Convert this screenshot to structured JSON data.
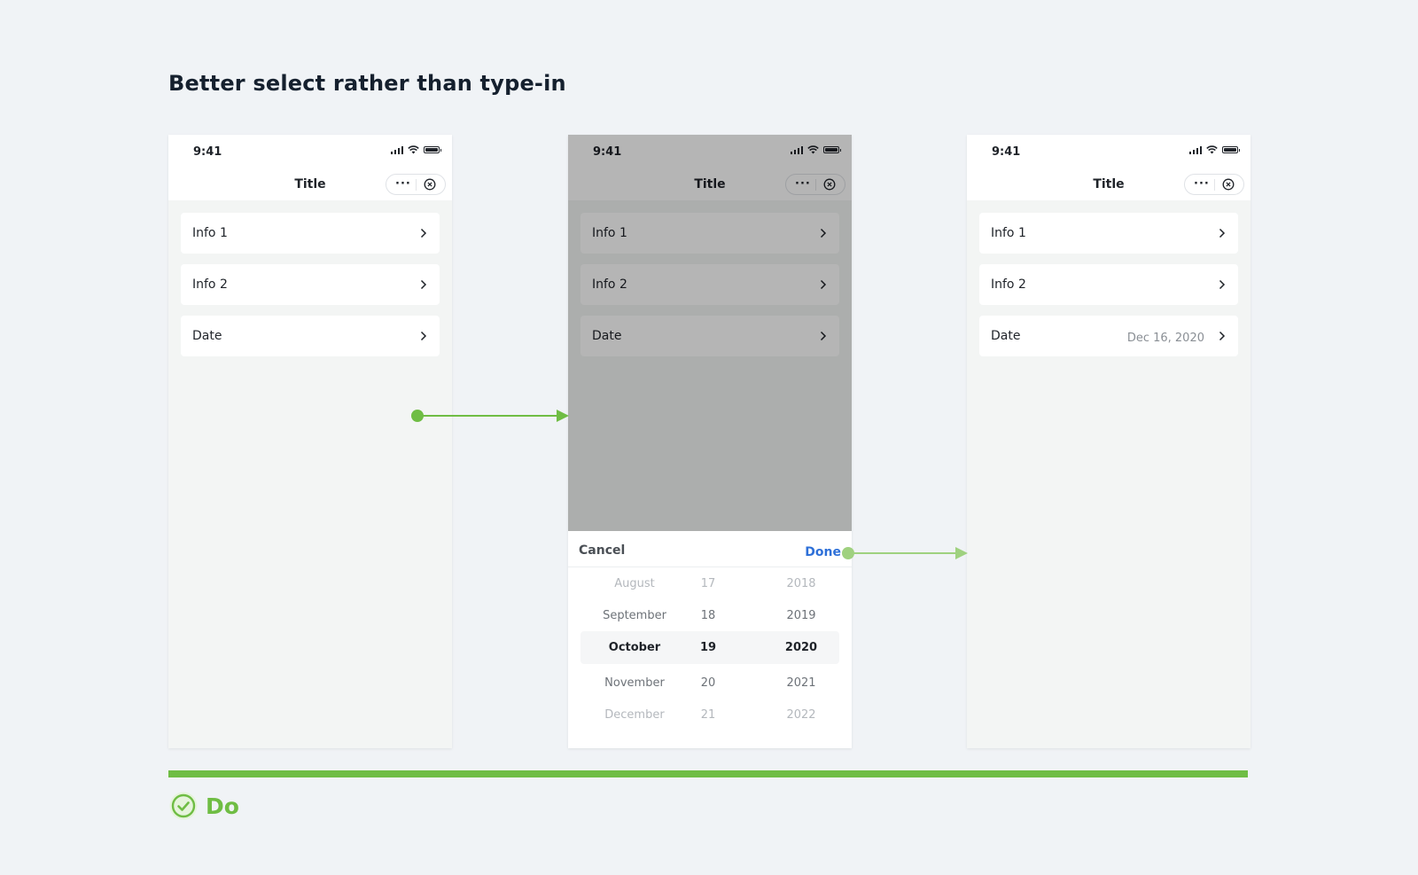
{
  "heading": "Better select rather than type-in",
  "colors": {
    "accent": "#6fbd44",
    "link": "#2e70d8",
    "background": "#f0f3f6"
  },
  "icons": [
    "signal-icon",
    "wifi-icon",
    "battery-icon",
    "more-icon",
    "close-circle-icon",
    "chevron-right-icon",
    "check-circle-icon"
  ],
  "phone_before": {
    "time": "9:41",
    "title": "Title",
    "more": "···",
    "rows": [
      {
        "label": "Info 1"
      },
      {
        "label": "Info 2"
      },
      {
        "label": "Date"
      }
    ]
  },
  "phone_picker": {
    "time": "9:41",
    "title": "Title",
    "more": "···",
    "rows": [
      {
        "label": "Info 1"
      },
      {
        "label": "Info 2"
      },
      {
        "label": "Date"
      }
    ],
    "picker": {
      "cancel": "Cancel",
      "done": "Done",
      "rows": [
        {
          "month": "August",
          "day": "17",
          "year": "2018"
        },
        {
          "month": "September",
          "day": "18",
          "year": "2019"
        },
        {
          "month": "October",
          "day": "19",
          "year": "2020"
        },
        {
          "month": "November",
          "day": "20",
          "year": "2021"
        },
        {
          "month": "December",
          "day": "21",
          "year": "2022"
        }
      ]
    }
  },
  "phone_after": {
    "time": "9:41",
    "title": "Title",
    "more": "···",
    "rows": [
      {
        "label": "Info 1"
      },
      {
        "label": "Info 2"
      },
      {
        "label": "Date",
        "value": "Dec 16, 2020"
      }
    ]
  },
  "footer": {
    "label": "Do"
  }
}
